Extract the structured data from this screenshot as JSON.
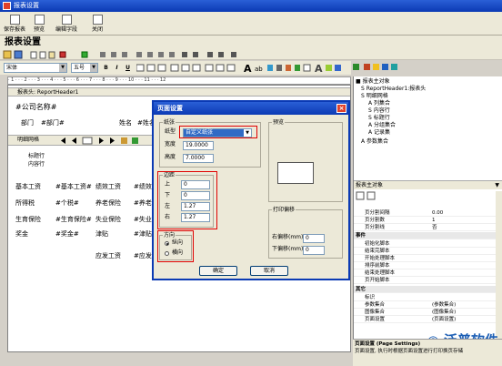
{
  "window": {
    "title": "报表设置"
  },
  "toolbar1": {
    "save_exit": "保存报表",
    "preview": "预览",
    "edit_fields": "编辑字段",
    "close": "关闭"
  },
  "page_title": "报表设置",
  "format_bar": {
    "font": "宋体",
    "size": "五号"
  },
  "ruler_text": "· 1 · · · 2 · · · 3 · · · 4 · · · 5 · · · 6 · · · 7 · · · 8 · · · 9 · · · 10 · · · 11 · · · 12",
  "design": {
    "header_band": "报表头: ReportHeader1",
    "company": "#公司名称#",
    "dept_label": "部门",
    "dept_field": "#部门#",
    "name_label": "姓名",
    "name_field": "#姓名",
    "detail_band": "明细网格",
    "title_row": "标题行",
    "content_row": "内容行",
    "grid": [
      [
        "基本工资",
        "#基本工资#",
        "绩效工资",
        "#绩效工"
      ],
      [
        "所得税",
        "#个税#",
        "养老保险",
        "#养老保"
      ],
      [
        "生育保险",
        "#生育保险#",
        "失业保险",
        "#失业保"
      ],
      [
        "奖金",
        "#奖金#",
        "津贴",
        "#津贴#"
      ]
    ],
    "payable_label": "应发工资",
    "payable_field": "#应发工"
  },
  "tree": {
    "root": "报表主对象",
    "items": [
      "S ReportHeader1:报表头",
      "S 明细网格",
      "A 列集合",
      "S 内容行",
      "S 标题行",
      "A 分组集合",
      "A 记录集",
      "A 参数集合"
    ]
  },
  "properties": {
    "object_label": "报表主对象",
    "rows": [
      {
        "k": "页分割间隔",
        "v": "0.00"
      },
      {
        "k": "页分割数",
        "v": "1"
      },
      {
        "k": "页分割线",
        "v": "否"
      }
    ],
    "events_header": "事件",
    "events": [
      "初始化脚本",
      "结束完脚本",
      "开始处理脚本",
      "排序前脚本",
      "结束处理脚本",
      "页开始脚本"
    ],
    "other_header": "其它",
    "others": [
      {
        "k": "标识",
        "v": ""
      },
      {
        "k": "参数集合",
        "v": "(参数集合)"
      },
      {
        "k": "图像集合",
        "v": "(图像集合)"
      },
      {
        "k": "页面设置",
        "v": "(页面设置)"
      }
    ]
  },
  "status": {
    "title": "页面设置 (Page Settings)",
    "desc": "页面设置, 执行时根据页面设置进行打印换页存储"
  },
  "watermark": "泛普软件",
  "dialog": {
    "title": "页面设置",
    "paper_group": "纸张",
    "paper_label": "纸型",
    "paper_value": "自定义纸张",
    "width_label": "宽度",
    "width_value": "19.0000",
    "height_label": "高度",
    "height_value": "7.0000",
    "preview_label": "预览",
    "margin_group": "边距",
    "top_label": "上",
    "top_value": "0",
    "bottom_label": "下",
    "bottom_value": "0",
    "left_label": "左",
    "left_value": "1.27",
    "right_label": "右",
    "right_value": "1.27",
    "orient_group": "方向",
    "portrait": "纵向",
    "landscape": "横向",
    "offset_group": "打印偏移",
    "offset_right_label": "右偏移(mm):",
    "offset_right_value": "0",
    "offset_down_label": "下偏移(mm):",
    "offset_down_value": "0",
    "ok": "确定",
    "cancel": "取消"
  }
}
